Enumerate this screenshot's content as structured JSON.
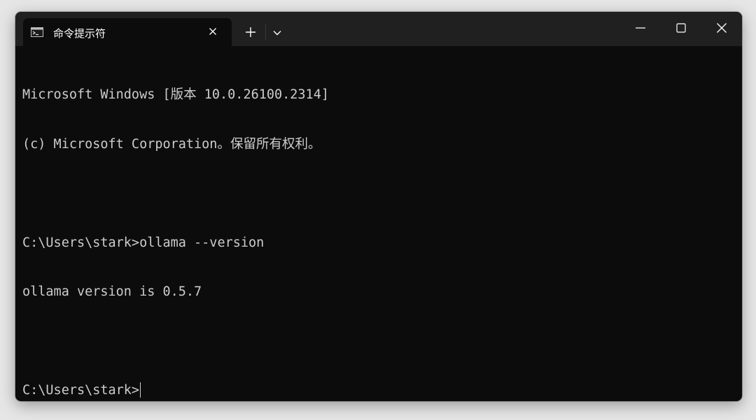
{
  "window": {
    "tab_title": "命令提示符"
  },
  "console": {
    "lines": [
      "Microsoft Windows [版本 10.0.26100.2314]",
      "(c) Microsoft Corporation。保留所有权利。",
      "",
      "C:\\Users\\stark>ollama --version",
      "ollama version is 0.5.7",
      "",
      "C:\\Users\\stark>"
    ]
  },
  "icons": {
    "tab_icon": "terminal-icon",
    "tab_close": "close-icon",
    "new_tab": "plus-icon",
    "dropdown": "chevron-down-icon",
    "minimize": "minimize-icon",
    "maximize": "maximize-icon",
    "close": "close-icon"
  },
  "colors": {
    "titlebar": "#202020",
    "tab_background": "#0c0c0c",
    "console_background": "#0c0c0c",
    "console_text": "#cccccc"
  }
}
